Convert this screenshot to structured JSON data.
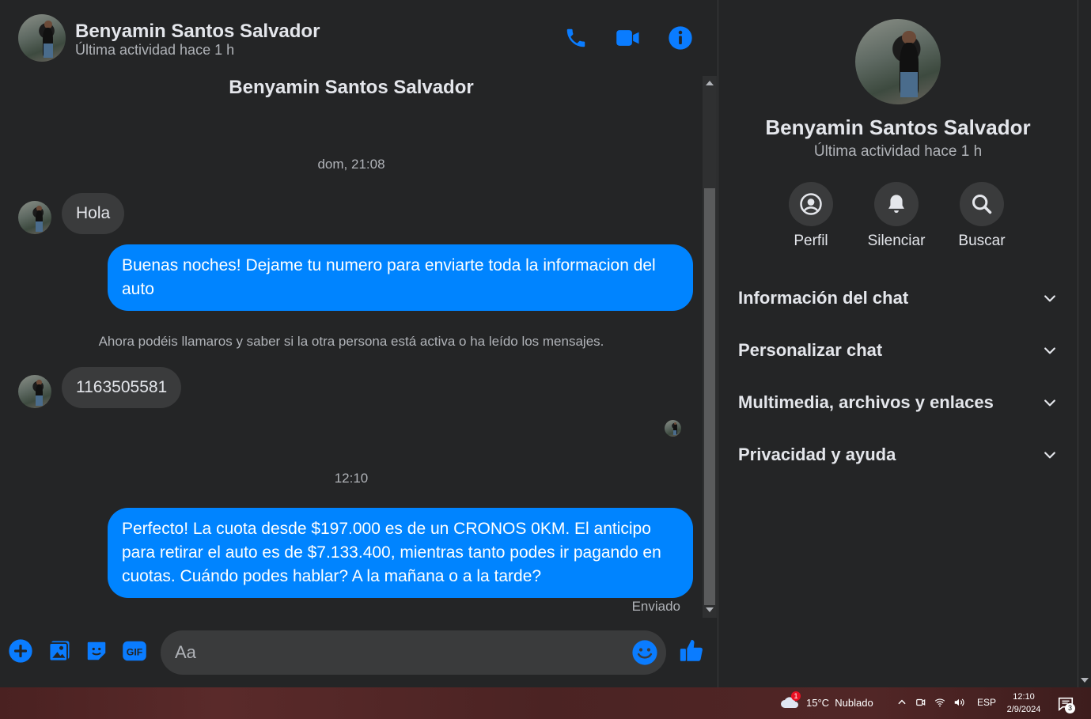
{
  "contact": {
    "name": "Benyamin Santos Salvador",
    "status": "Última actividad hace 1 h"
  },
  "header_icons": [
    "phone-icon",
    "video-camera-icon",
    "info-icon"
  ],
  "conversation": {
    "title": "Benyamin Santos Salvador",
    "timestamp_1": "dom, 21:08",
    "msg_in_1": "Hola",
    "msg_out_1": "Buenas noches! Dejame tu numero para enviarte toda la informacion del auto",
    "system_note": "Ahora podéis llamaros y saber si la otra persona está activa o ha leído los mensajes.",
    "msg_in_2": "1163505581",
    "timestamp_2": "12:10",
    "msg_out_2": "Perfecto! La cuota desde $197.000 es de un CRONOS 0KM. El anticipo para retirar el auto es de $7.133.400, mientras tanto podes ir pagando en cuotas. Cuándo podes hablar? A la mañana o a la tarde?",
    "delivery_status": "Enviado"
  },
  "composer": {
    "placeholder": "Aa",
    "icons": [
      "plus-icon",
      "photo-icon",
      "sticker-icon",
      "gif-icon",
      "emoji-icon",
      "like-icon"
    ]
  },
  "panel": {
    "name": "Benyamin Santos Salvador",
    "status": "Última actividad hace 1 h",
    "actions": [
      {
        "label": "Perfil",
        "icon": "profile-icon"
      },
      {
        "label": "Silenciar",
        "icon": "bell-icon"
      },
      {
        "label": "Buscar",
        "icon": "search-icon"
      }
    ],
    "sections": [
      "Información del chat",
      "Personalizar chat",
      "Multimedia, archivos y enlaces",
      "Privacidad y ayuda"
    ]
  },
  "taskbar": {
    "weather": "15°C  Nublado",
    "weather_badge": "1",
    "language": "ESP",
    "time": "12:10",
    "date": "2/9/2024",
    "notifications": "3"
  },
  "colors": {
    "accent": "#0084ff",
    "background": "#242526",
    "bubble_in": "#3a3b3c",
    "text_secondary": "#b0b3b8"
  }
}
